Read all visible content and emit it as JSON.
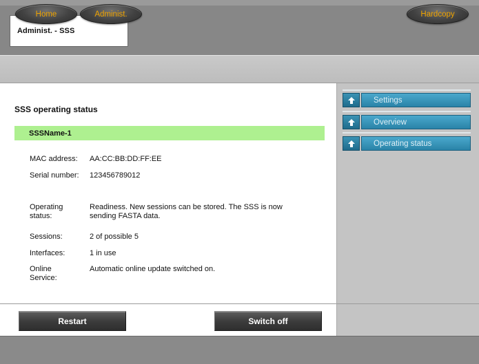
{
  "window": {
    "title": "Administ. - SSS"
  },
  "nav": {
    "home": "Home",
    "administ": "Administ.",
    "hardcopy": "Hardcopy",
    "accent_color": "#f0a400"
  },
  "main": {
    "title": "SSS operating status",
    "device_name": "SSSName-1",
    "device_bar_color": "#aef090",
    "fields": {
      "mac_label": "MAC address:",
      "mac_value": "AA:CC:BB:DD:FF:EE",
      "serial_label": "Serial number:",
      "serial_value": "123456789012",
      "operating_label_1": "Operating",
      "operating_label_2": "status:",
      "operating_value_1": "Readiness. New sessions can be stored. The SSS is now",
      "operating_value_2": "sending FASTA data.",
      "sessions_label": "Sessions:",
      "sessions_value": "2 of possible 5",
      "interfaces_label": "Interfaces:",
      "interfaces_value": "1 in use",
      "online_label_1": "Online",
      "online_label_2": "Service:",
      "online_value": "Automatic online update switched on."
    }
  },
  "side_menu": {
    "items": [
      {
        "label": "Settings",
        "icon": "arrow-up-icon"
      },
      {
        "label": "Overview",
        "icon": "arrow-up-icon"
      },
      {
        "label": "Operating status",
        "icon": "arrow-up-icon"
      }
    ],
    "menu_color": "#2a83a8"
  },
  "actions": {
    "restart": "Restart",
    "switch_off": "Switch off"
  }
}
